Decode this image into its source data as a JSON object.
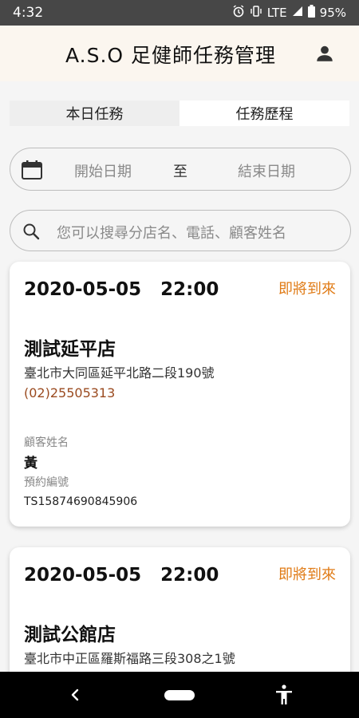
{
  "status_bar": {
    "time": "4:32",
    "network": "LTE",
    "battery": "95%",
    "icons": [
      "alarm-icon",
      "vibrate-icon",
      "lte-signal-icon",
      "battery-icon"
    ]
  },
  "header": {
    "title": "A.S.O 足健師任務管理",
    "profile_icon": "person-icon"
  },
  "tabs": [
    {
      "label": "本日任務",
      "active": false
    },
    {
      "label": "任務歷程",
      "active": true
    }
  ],
  "date_filter": {
    "start_placeholder": "開始日期",
    "separator": "至",
    "end_placeholder": "結束日期"
  },
  "search": {
    "placeholder": "您可以搜尋分店名、電話、顧客姓名"
  },
  "tasks": [
    {
      "datetime": "2020-05-05   22:00",
      "status": "即將到來",
      "store": "測試延平店",
      "address": "臺北市大同區延平北路二段190號",
      "phone": "(02)25505313",
      "customer_label": "顧客姓名",
      "customer": "黃",
      "reservation_label": "預約編號",
      "reservation_no": "TS15874690845906"
    },
    {
      "datetime": "2020-05-05   22:00",
      "status": "即將到來",
      "store": "測試公館店",
      "address": "臺北市中正區羅斯福路三段308之1號"
    }
  ],
  "colors": {
    "status_accent": "#e07b16",
    "phone": "#9a4a1f",
    "header_bg": "#fbf6ef",
    "status_bar_bg": "#474747"
  }
}
